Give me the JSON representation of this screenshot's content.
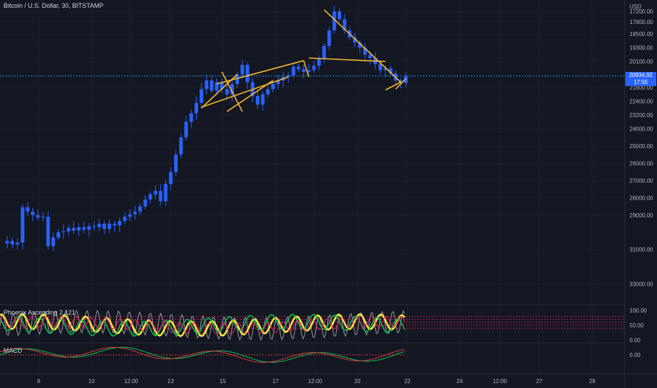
{
  "header": {
    "title": "Bitcoin / U.S. Dollar, 30, BITSTAMP",
    "currency": "USD"
  },
  "price_tag": {
    "price": "20934.92",
    "countdown": "17:55"
  },
  "panels": {
    "indicator_title": "Phoenix Ascending 2.121",
    "macd_title": "MACD"
  },
  "colors": {
    "background": "#131722",
    "grid": "#1e222d",
    "candle": "#2962ff",
    "pattern": "#f5b82a",
    "price_line": "#2196f3",
    "osc_yellow": "#ffeb3b",
    "osc_green": "#00c853",
    "osc_gray": "#9598a1",
    "osc_pink": "#e91e63",
    "macd_green": "#00c853",
    "macd_red": "#e53935"
  },
  "chart_data": {
    "type": "line",
    "title": "Bitcoin / U.S. Dollar, 30, BITSTAMP",
    "x_ticks": [
      "8",
      "10",
      "12:00",
      "13",
      "15",
      "17",
      "12:00",
      "20",
      "22",
      "24",
      "12:00",
      "27",
      "29"
    ],
    "y_ticks": [
      "17200.00",
      "17800.00",
      "18500.00",
      "19300.00",
      "20100.00",
      "21600.00",
      "22400.00",
      "23200.00",
      "24000.00",
      "25000.00",
      "26000.00",
      "27000.00",
      "28000.00",
      "29000.00",
      "31000.00",
      "33000.00"
    ],
    "y_axis_inverted": true,
    "ylim": [
      16700,
      34200
    ],
    "series": [
      {
        "values": [
          30650,
          30500,
          30700,
          30600,
          28550,
          28800,
          29000,
          29150,
          29100,
          30800,
          30300,
          30000,
          29950,
          29750,
          29900,
          29700,
          29850,
          29650,
          29700,
          29500,
          29800,
          29500,
          29600,
          29350,
          29100,
          28950,
          28800,
          28500,
          28100,
          27800,
          27600,
          28200,
          27200,
          26500,
          25500,
          24500,
          23600,
          23100,
          22500,
          21700,
          21200,
          21800,
          21300,
          21700,
          22000,
          21400,
          20850,
          20300,
          21300,
          22100,
          22600,
          22000,
          21700,
          21400,
          21200,
          21000,
          20900,
          20400,
          20550,
          20700,
          20600,
          20350,
          19950,
          19200,
          18300,
          17200,
          17650,
          18300,
          18700,
          19000,
          19300,
          19700,
          19900,
          20250,
          20600,
          20500,
          20800,
          21200,
          21350,
          20950
        ]
      }
    ],
    "pattern_lines": [
      [
        [
          42,
          21400
        ],
        [
          59,
          20050
        ]
      ],
      [
        [
          39,
          22750
        ],
        [
          56,
          21000
        ]
      ],
      [
        [
          39,
          22800
        ],
        [
          46,
          20850
        ]
      ],
      [
        [
          44,
          23000
        ],
        [
          53,
          21200
        ]
      ],
      [
        [
          43,
          20700
        ],
        [
          47,
          23000
        ]
      ],
      [
        [
          59,
          20050
        ],
        [
          60,
          21000
        ]
      ],
      [
        [
          60,
          19900
        ],
        [
          75,
          20100
        ]
      ],
      [
        [
          63,
          17100
        ],
        [
          78,
          21300
        ]
      ],
      [
        [
          78,
          21300
        ],
        [
          75,
          21750
        ]
      ],
      [
        [
          77,
          21700
        ],
        [
          79,
          21100
        ]
      ]
    ],
    "indicator": {
      "y_ticks": [
        "100.00",
        "50.00",
        "0.00"
      ]
    },
    "macd": {
      "y_ticks": [
        "0.00"
      ]
    }
  }
}
